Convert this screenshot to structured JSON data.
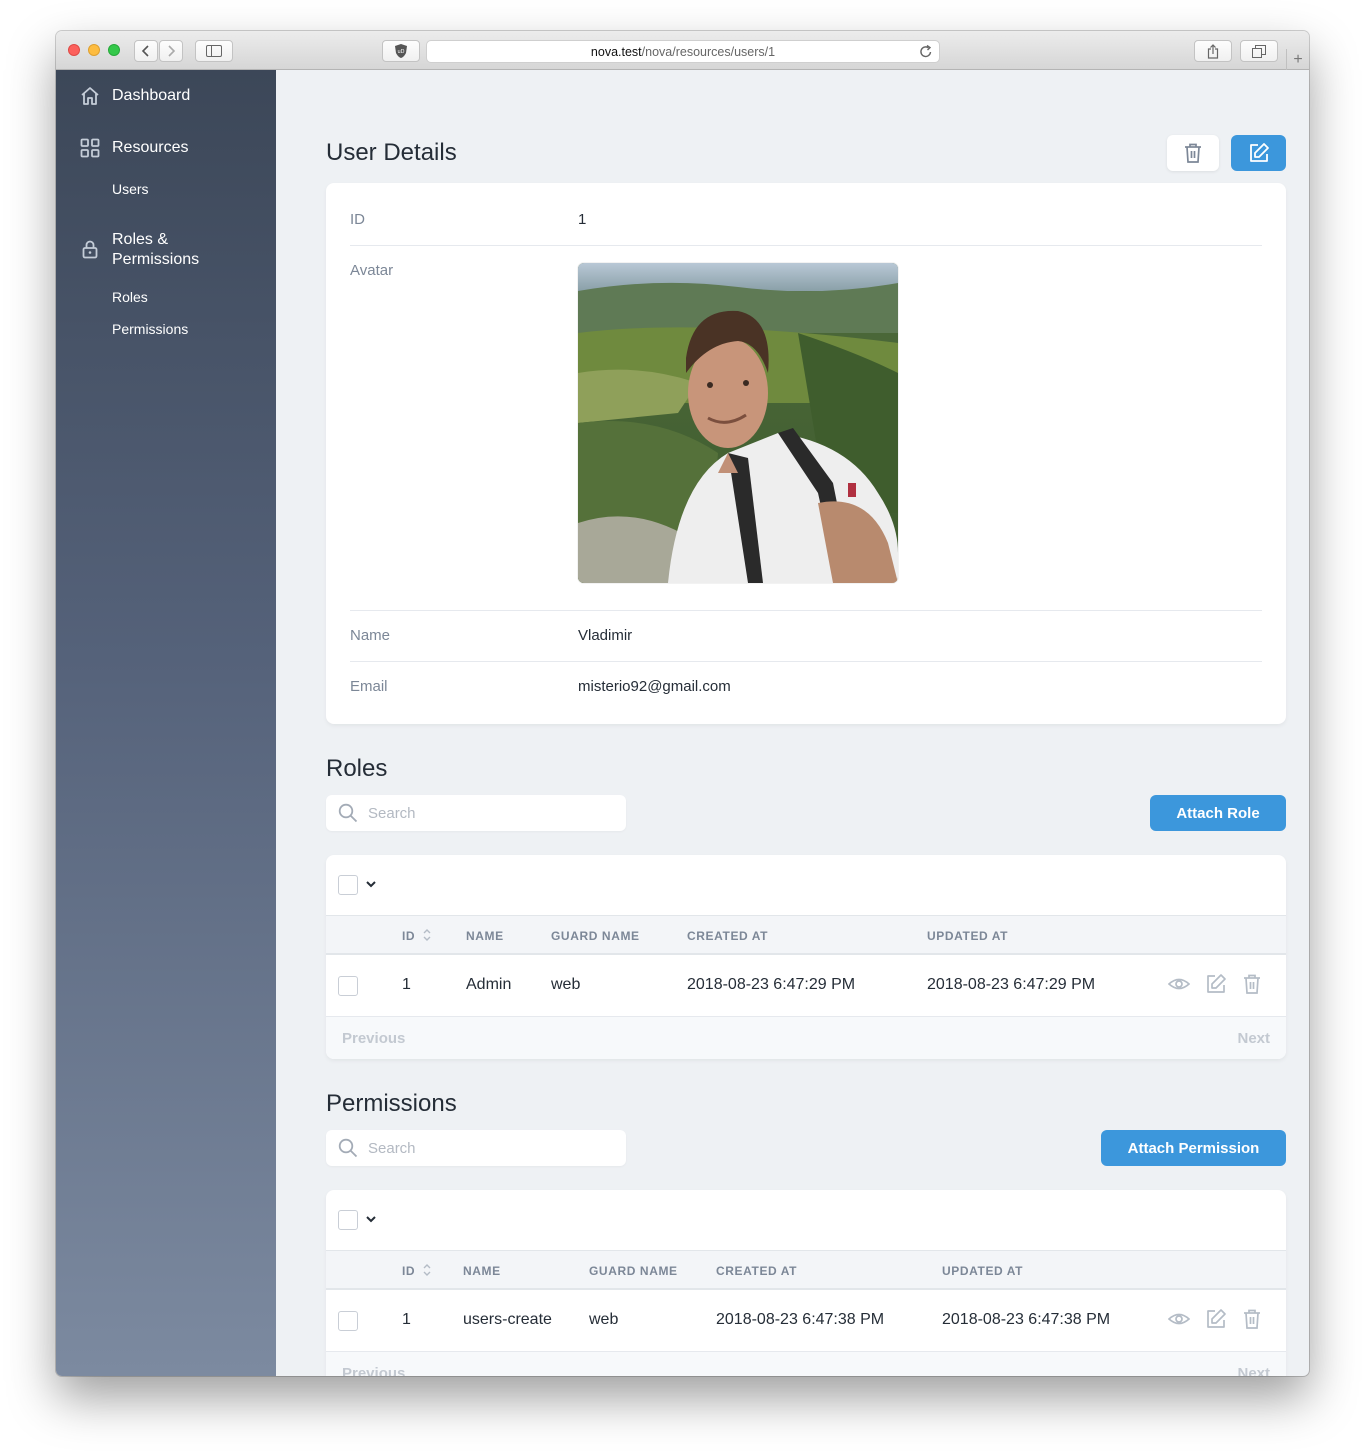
{
  "browser": {
    "url_host": "nova.test",
    "url_path": "/nova/resources/users/1"
  },
  "sidebar": {
    "dashboard": "Dashboard",
    "resources": "Resources",
    "users": "Users",
    "roles_permissions": "Roles & Permissions",
    "roles": "Roles",
    "permissions": "Permissions"
  },
  "user_details": {
    "title": "User Details",
    "fields": [
      {
        "label": "ID",
        "value": "1"
      },
      {
        "label": "Avatar",
        "value": ""
      },
      {
        "label": "Name",
        "value": "Vladimir"
      },
      {
        "label": "Email",
        "value": "misterio92@gmail.com"
      }
    ]
  },
  "roles": {
    "title": "Roles",
    "search_placeholder": "Search",
    "attach_label": "Attach Role",
    "columns": [
      "ID",
      "NAME",
      "GUARD NAME",
      "CREATED AT",
      "UPDATED AT"
    ],
    "rows": [
      {
        "id": "1",
        "name": "Admin",
        "guard": "web",
        "created": "2018-08-23 6:47:29 PM",
        "updated": "2018-08-23 6:47:29 PM"
      }
    ],
    "prev": "Previous",
    "next": "Next"
  },
  "permissions": {
    "title": "Permissions",
    "search_placeholder": "Search",
    "attach_label": "Attach Permission",
    "columns": [
      "ID",
      "NAME",
      "GUARD NAME",
      "CREATED AT",
      "UPDATED AT"
    ],
    "rows": [
      {
        "id": "1",
        "name": "users-create",
        "guard": "web",
        "created": "2018-08-23 6:47:38 PM",
        "updated": "2018-08-23 6:47:38 PM"
      }
    ],
    "prev": "Previous",
    "next": "Next"
  },
  "colors": {
    "primary": "#3c97dc",
    "sidebar_top": "#3c4758",
    "sidebar_bottom": "#7c8aa0",
    "background": "#eef1f4"
  }
}
